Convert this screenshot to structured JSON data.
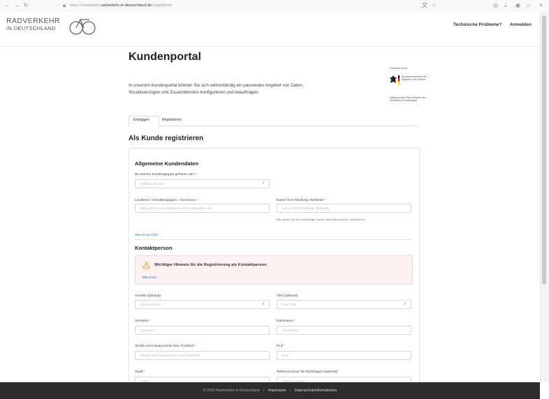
{
  "browser": {
    "url_prefix": "https://marktplatz.",
    "url_domain": "radverkehr-in-deutschland.de",
    "url_path": "/registrieren"
  },
  "header": {
    "logo_line1": "RADVERKEHR",
    "logo_line2": "IN DEUTSCHLAND",
    "tech_problems": "Technische Probleme?",
    "login": "Anmelden"
  },
  "page": {
    "title": "Kundenportal",
    "intro": "In unserem Kundenportal können Sie sich selbstständig ein passendes Angebot von Daten, Visualisierungen und Zusatzdiensten konfigurieren und beauftragen.",
    "funder_top": "Gefördert durch:",
    "funder_ministry": "Bundesministerium für Digitales und Verkehr",
    "funder_bottom": "aufgrund eines Beschlusses des Deutschen Bundestages"
  },
  "tabs": {
    "login": "Einloggen",
    "register": "Registrieren"
  },
  "form": {
    "heading": "Als Kunde registrieren",
    "general": {
      "title": "Allgemeine Kundendaten",
      "group_label": "Zu welcher Kundengruppe gehören Sie?",
      "group_placeholder": "Wählen Sie aus",
      "district_label": "Landkreis / Verwaltungsgem. / Kommune",
      "district_placeholder": "Bitte geben Sie mindestens drei Buchstaben ein",
      "department_label": "Name Ihrer Abteilung / Behörde",
      "department_placeholder": "Name Ihrer Abteilung / Behörde",
      "department_hint": "Bitte geben Sie den vollständigen Namen Ihrer Abteilung bzw. Institution an.",
      "ags_link": "Was ist ein AGS?"
    },
    "contact": {
      "title": "Kontaktperson",
      "alert_title": "Wichtiger Hinweis für die Registrierung als Kontaktperson",
      "alert_link": "Bitte lesen",
      "salutation_label": "Anrede (optional)",
      "salutation_placeholder": "Keine Anrede",
      "title_label": "Titel (optional)",
      "title_placeholder": "Kein Titel",
      "firstname_label": "Vorname",
      "firstname_placeholder": "Vorname",
      "lastname_label": "Nachname",
      "lastname_placeholder": "Nachname",
      "street_label": "Straße und Hausnummer bzw. Postfach",
      "street_placeholder": "Straße und Hausnummer bzw. Postfach",
      "zip_label": "PLZ",
      "zip_placeholder": "PLZ",
      "city_label": "Stadt",
      "city_placeholder": "Stadt",
      "phone_label": "Telefonnummer für Rückfragen (optional)",
      "phone_placeholder": "Telefonnummer"
    },
    "required_mark": "*"
  },
  "footer": {
    "copyright": "© 2023 Radverkehr in Deutschland",
    "imprint": "Impressum",
    "privacy": "Datenschutzinformationen",
    "separator": "|"
  }
}
